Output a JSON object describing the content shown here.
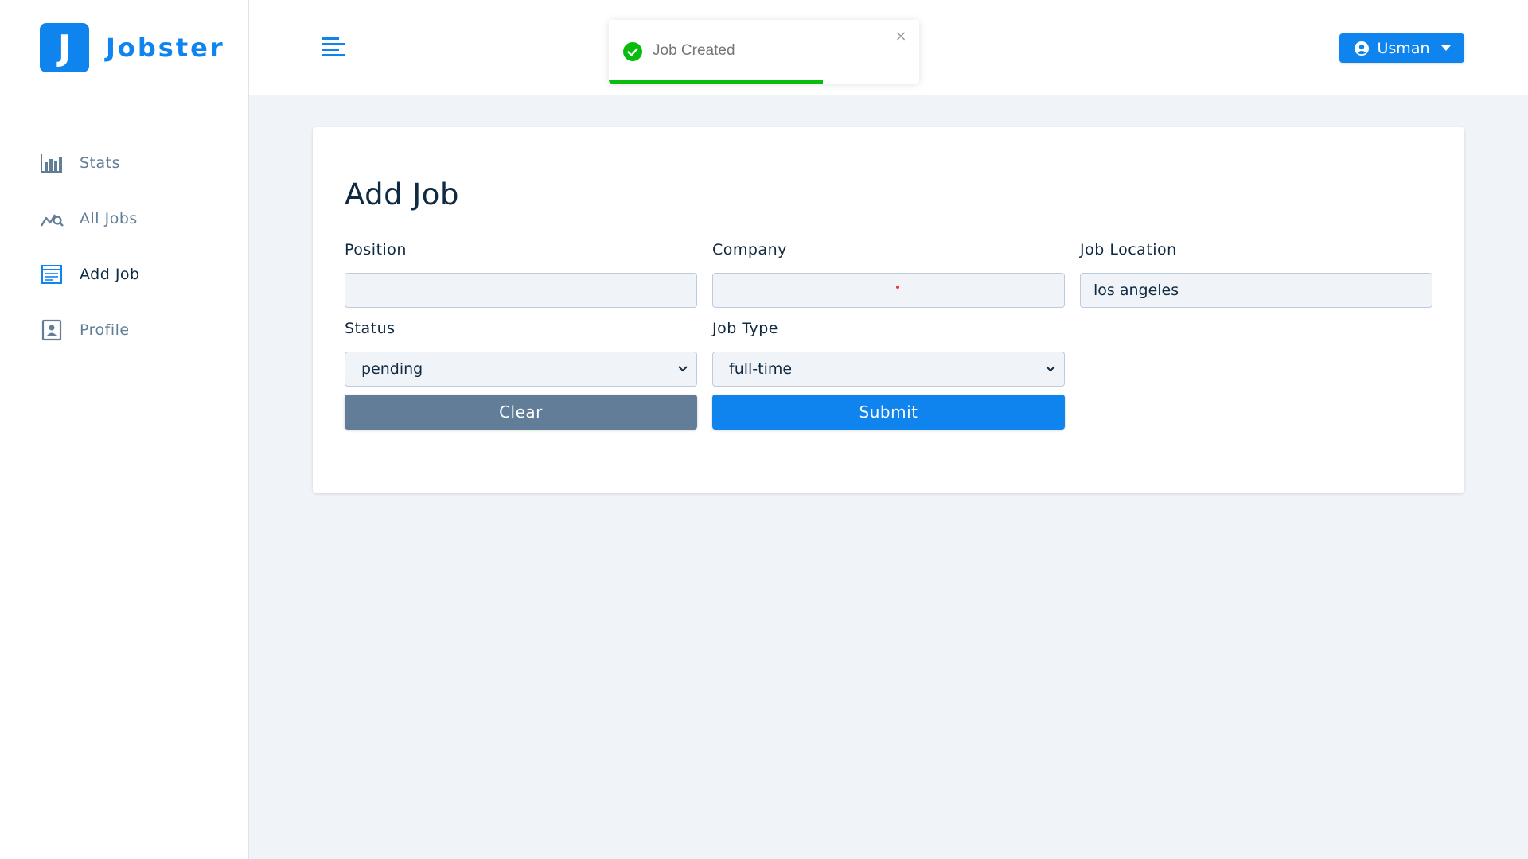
{
  "app": {
    "logo_letter": "J",
    "logo_text": "Jobster"
  },
  "sidebar": {
    "items": [
      {
        "label": "Stats",
        "icon": "bar-chart-icon",
        "active": false
      },
      {
        "label": "All Jobs",
        "icon": "line-chart-search-icon",
        "active": false
      },
      {
        "label": "Add Job",
        "icon": "form-icon",
        "active": true
      },
      {
        "label": "Profile",
        "icon": "profile-card-icon",
        "active": false
      }
    ]
  },
  "navbar": {
    "toggle_icon": "menu-align-left-icon",
    "user_name": "Usman",
    "user_icon": "user-circle-icon",
    "caret_icon": "caret-down-icon"
  },
  "toast": {
    "message": "Job Created",
    "icon": "success-check-icon",
    "close_symbol": "×",
    "progress_percent": 69
  },
  "form": {
    "title": "Add Job",
    "position": {
      "label": "Position",
      "value": ""
    },
    "company": {
      "label": "Company",
      "value": ""
    },
    "job_location": {
      "label": "Job Location",
      "value": "los angeles"
    },
    "status": {
      "label": "Status",
      "value": "pending"
    },
    "job_type": {
      "label": "Job Type",
      "value": "full-time"
    },
    "clear_label": "Clear",
    "submit_label": "Submit"
  },
  "colors": {
    "primary": "#0f84ee",
    "clear_button": "#617d98",
    "toast_success": "#07bc0c",
    "background": "#f0f4f8"
  }
}
